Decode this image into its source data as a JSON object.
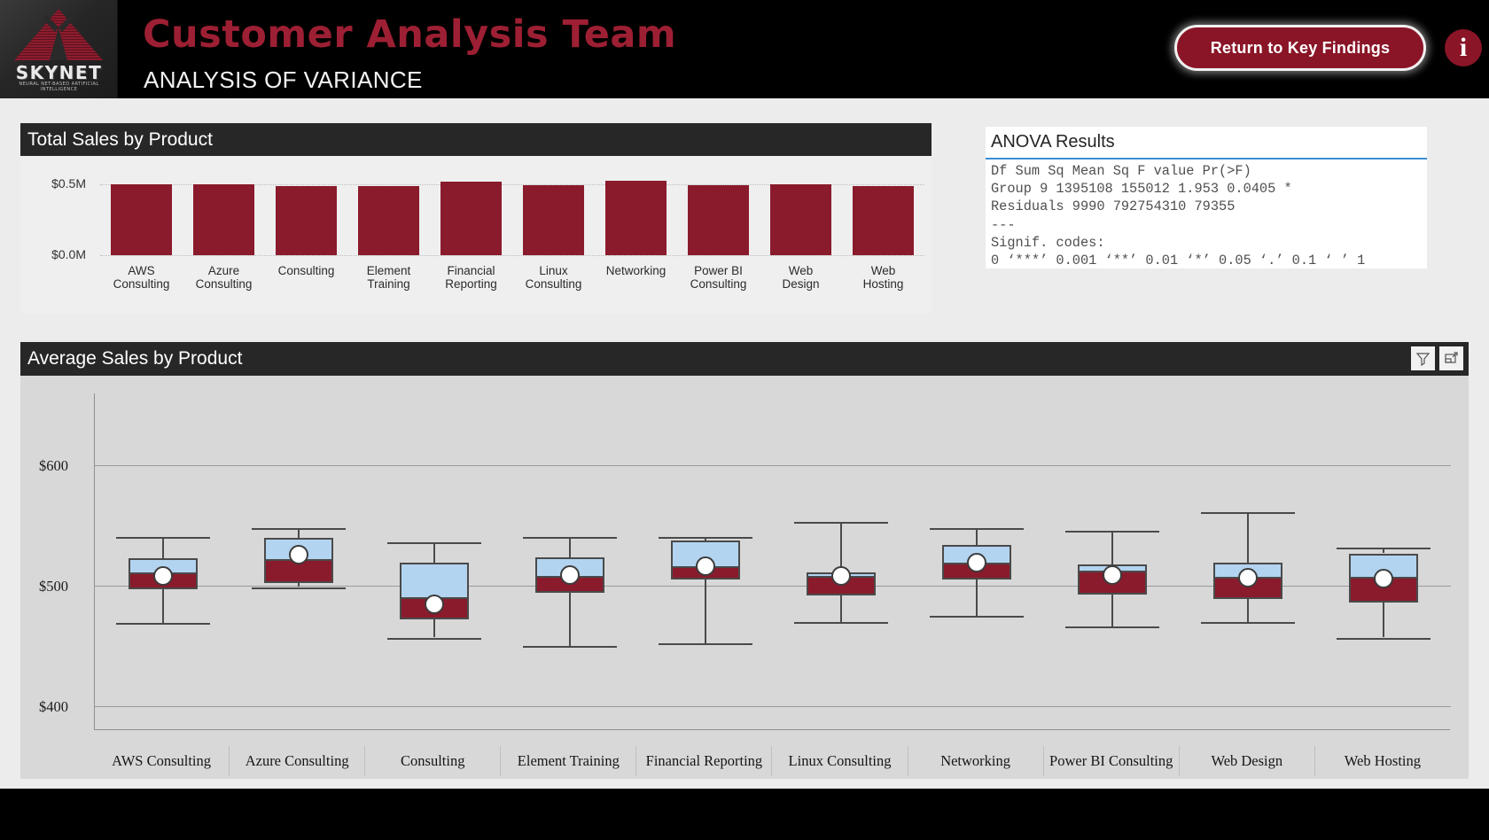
{
  "header": {
    "logo": {
      "word": "SKYNET",
      "subtitle": "NEURAL NET-BASED ARTIFICIAL INTELLIGENCE"
    },
    "title": "Customer Analysis Team",
    "subtitle": "ANALYSIS OF VARIANCE",
    "return_button": "Return to Key Findings",
    "info_icon": "i",
    "accent_red": "#9d1f33",
    "background": "#000000"
  },
  "bar_card": {
    "title": "Total Sales by Product"
  },
  "anova": {
    "title": "ANOVA Results",
    "text": "Df Sum Sq Mean Sq F value Pr(>F)\nGroup 9 1395108 155012 1.953 0.0405 *\nResiduals 9990 792754310 79355\n---\nSignif. codes:\n0 ‘***’ 0.001 ‘**’ 0.01 ‘*’ 0.05 ‘.’ 0.1 ‘ ’ 1",
    "rows": [
      {
        "term": "Group",
        "df": "9",
        "sum_sq": "1395108",
        "mean_sq": "155012",
        "f_value": "1.953",
        "pr": "0.0405",
        "signif": "*"
      },
      {
        "term": "Residuals",
        "df": "9990",
        "sum_sq": "792754310",
        "mean_sq": "79355",
        "f_value": "",
        "pr": "",
        "signif": ""
      }
    ]
  },
  "box_card": {
    "title": "Average Sales by Product",
    "icons": [
      {
        "name": "filter-icon",
        "label": "Filter"
      },
      {
        "name": "focus-mode-icon",
        "label": "Focus mode"
      }
    ]
  },
  "chart_data": [
    {
      "type": "bar",
      "title": "Total Sales by Product",
      "xlabel": "",
      "ylabel": "",
      "ylim": [
        0,
        0.56
      ],
      "ytick_labels": [
        "$0.0M",
        "$0.5M"
      ],
      "ytick_values": [
        0.0,
        0.5
      ],
      "grid": true,
      "categories": [
        "AWS Consulting",
        "Azure Consulting",
        "Consulting",
        "Element Training",
        "Financial Reporting",
        "Linux Consulting",
        "Networking",
        "Power BI Consulting",
        "Web Design",
        "Web Hosting"
      ],
      "category_lines": [
        [
          "AWS",
          "Consulting"
        ],
        [
          "Azure",
          "Consulting"
        ],
        [
          "Consulting",
          ""
        ],
        [
          "Element",
          "Training"
        ],
        [
          "Financial",
          "Reporting"
        ],
        [
          "Linux",
          "Consulting"
        ],
        [
          "Networking",
          ""
        ],
        [
          "Power BI",
          "Consulting"
        ],
        [
          "Web",
          "Design"
        ],
        [
          "Web",
          "Hosting"
        ]
      ],
      "values": [
        0.5,
        0.499,
        0.486,
        0.487,
        0.519,
        0.489,
        0.521,
        0.492,
        0.495,
        0.483
      ],
      "bar_color": "#8a1b2c"
    },
    {
      "type": "box",
      "title": "Average Sales by Product",
      "xlabel": "",
      "ylabel": "",
      "ylim": [
        380,
        660
      ],
      "ytick_labels": [
        "$400",
        "$500",
        "$600"
      ],
      "ytick_values": [
        400,
        500,
        600
      ],
      "grid": true,
      "mean_marker": "white-circle",
      "q3_fill": "#b3d4f0",
      "q1_fill": "#8a1b2c",
      "categories": [
        "AWS Consulting",
        "Azure Consulting",
        "Consulting",
        "Element Training",
        "Financial Reporting",
        "Linux Consulting",
        "Networking",
        "Power BI Consulting",
        "Web Design",
        "Web Hosting"
      ],
      "boxes": [
        {
          "name": "AWS Consulting",
          "min": 469,
          "q1": 497,
          "median": 510,
          "q3": 523,
          "max": 541,
          "mean": 508
        },
        {
          "name": "Azure Consulting",
          "min": 499,
          "q1": 502,
          "median": 521,
          "q3": 540,
          "max": 548,
          "mean": 526
        },
        {
          "name": "Consulting",
          "min": 457,
          "q1": 472,
          "median": 489,
          "q3": 519,
          "max": 536,
          "mean": 485
        },
        {
          "name": "Element Training",
          "min": 450,
          "q1": 494,
          "median": 507,
          "q3": 524,
          "max": 541,
          "mean": 509
        },
        {
          "name": "Financial Reporting",
          "min": 452,
          "q1": 505,
          "median": 515,
          "q3": 538,
          "max": 541,
          "mean": 516
        },
        {
          "name": "Linux Consulting",
          "min": 470,
          "q1": 492,
          "median": 507,
          "q3": 511,
          "max": 553,
          "mean": 508
        },
        {
          "name": "Networking",
          "min": 475,
          "q1": 505,
          "median": 518,
          "q3": 534,
          "max": 548,
          "mean": 519
        },
        {
          "name": "Power BI Consulting",
          "min": 466,
          "q1": 493,
          "median": 511,
          "q3": 518,
          "max": 546,
          "mean": 509
        },
        {
          "name": "Web Design",
          "min": 470,
          "q1": 489,
          "median": 506,
          "q3": 519,
          "max": 561,
          "mean": 507
        },
        {
          "name": "Web Hosting",
          "min": 457,
          "q1": 486,
          "median": 506,
          "q3": 527,
          "max": 532,
          "mean": 506
        }
      ]
    }
  ]
}
